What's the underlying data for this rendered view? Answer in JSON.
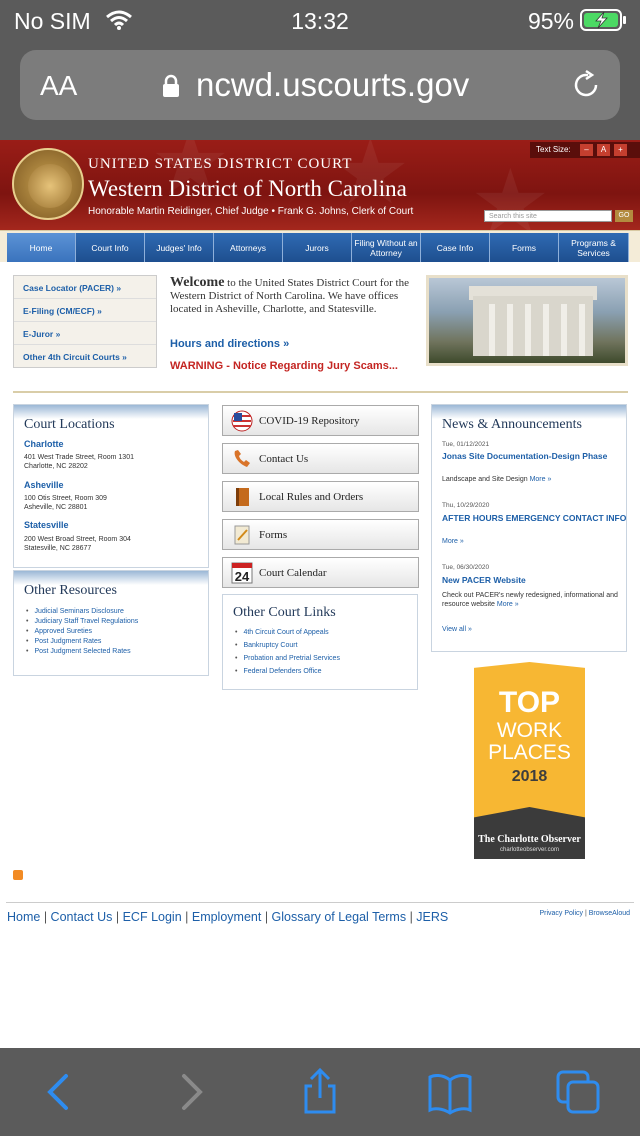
{
  "status": {
    "carrier": "No SIM",
    "time": "13:32",
    "battery_pct": "95%"
  },
  "browser": {
    "aa": "AA",
    "host": "ncwd.uscourts.gov"
  },
  "header": {
    "court": "UNITED STATES DISTRICT COURT",
    "district": "Western District of North Carolina",
    "officials": "Honorable Martin Reidinger, Chief Judge • Frank G. Johns, Clerk of Court",
    "text_size_label": "Text Size:",
    "search_placeholder": "Search this site",
    "go_label": "GO"
  },
  "nav": [
    {
      "label": "Home"
    },
    {
      "label": "Court Info"
    },
    {
      "label": "Judges' Info"
    },
    {
      "label": "Attorneys"
    },
    {
      "label": "Jurors"
    },
    {
      "label": "Filing Without an Attorney"
    },
    {
      "label": "Case Info"
    },
    {
      "label": "Forms"
    },
    {
      "label": "Programs & Services"
    }
  ],
  "quicklinks": [
    "Case Locator (PACER) »",
    "E-Filing (CM/ECF) »",
    "E-Juror »",
    "Other 4th Circuit Courts »"
  ],
  "welcome": {
    "lead": "Welcome",
    "body": " to the United States District Court for the Western District of North Carolina. We have offices located in Asheville, Charlotte, and Statesville.",
    "hours": "Hours and directions »",
    "warning": "WARNING - Notice Regarding Jury Scams..."
  },
  "locations": {
    "title": "Court Locations",
    "items": [
      {
        "city": "Charlotte",
        "line1": "401 West Trade Street, Room 1301",
        "line2": "Charlotte, NC  28202"
      },
      {
        "city": "Asheville",
        "line1": "100 Otis Street, Room 309",
        "line2": "Asheville, NC  28801"
      },
      {
        "city": "Statesville",
        "line1": "200 West Broad Street, Room 304",
        "line2": "Statesville, NC  28677"
      }
    ]
  },
  "resources": {
    "title": "Other Resources",
    "items": [
      "Judicial Seminars Disclosure",
      "Judiciary Staff Travel Regulations",
      "Approved Sureties",
      "Post Judgment Rates",
      "Post Judgment Selected Rates"
    ]
  },
  "shortcuts": [
    "COVID-19 Repository",
    "Contact Us",
    "Local Rules and Orders",
    "Forms",
    "Court Calendar"
  ],
  "calendar_day": "24",
  "court_links": {
    "title": "Other Court Links",
    "items": [
      "4th Circuit Court of Appeals",
      "Bankruptcy Court",
      "Probation and Pretrial Services",
      "Federal Defenders Office"
    ]
  },
  "news": {
    "title": "News & Announcements",
    "items": [
      {
        "date": "Tue, 01/12/2021",
        "title": "Jonas Site Documentation-Design Phase",
        "desc": "Landscape and Site Design",
        "more": "More »"
      },
      {
        "date": "Thu, 10/29/2020",
        "title": "AFTER HOURS EMERGENCY CONTACT INFO",
        "desc": "",
        "more": "More »"
      },
      {
        "date": "Tue, 06/30/2020",
        "title": "New PACER Website",
        "desc": "Check out PACER's newly redesigned, informational and resource website",
        "more": "More »"
      }
    ],
    "view_all": "View all »"
  },
  "badge": {
    "line1": "TOP",
    "line2": "WORK",
    "line3": "PLACES",
    "year": "2018",
    "paper": "The Charlotte Observer",
    "site": "charlotteobserver.com"
  },
  "footer": {
    "links": [
      "Home",
      "Contact Us",
      "ECF Login",
      "Employment",
      "Glossary of Legal Terms",
      "JERS"
    ],
    "small": [
      "Privacy Policy",
      "BrowseAloud"
    ]
  }
}
